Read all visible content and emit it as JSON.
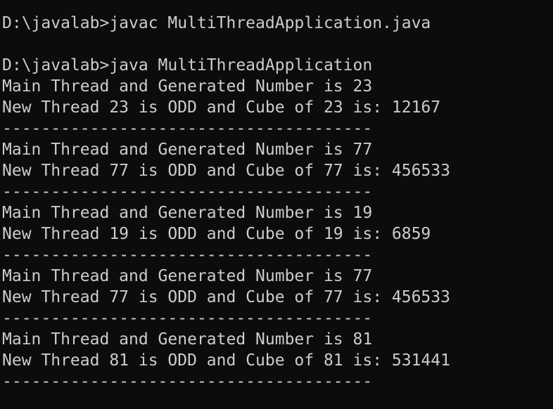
{
  "console": {
    "lines": [
      "D:\\javalab>javac MultiThreadApplication.java",
      "",
      "D:\\javalab>java MultiThreadApplication",
      "Main Thread and Generated Number is 23",
      "New Thread 23 is ODD and Cube of 23 is: 12167",
      "--------------------------------------",
      "Main Thread and Generated Number is 77",
      "New Thread 77 is ODD and Cube of 77 is: 456533",
      "--------------------------------------",
      "Main Thread and Generated Number is 19",
      "New Thread 19 is ODD and Cube of 19 is: 6859",
      "--------------------------------------",
      "Main Thread and Generated Number is 77",
      "New Thread 77 is ODD and Cube of 77 is: 456533",
      "--------------------------------------",
      "Main Thread and Generated Number is 81",
      "New Thread 81 is ODD and Cube of 81 is: 531441",
      "--------------------------------------"
    ]
  }
}
